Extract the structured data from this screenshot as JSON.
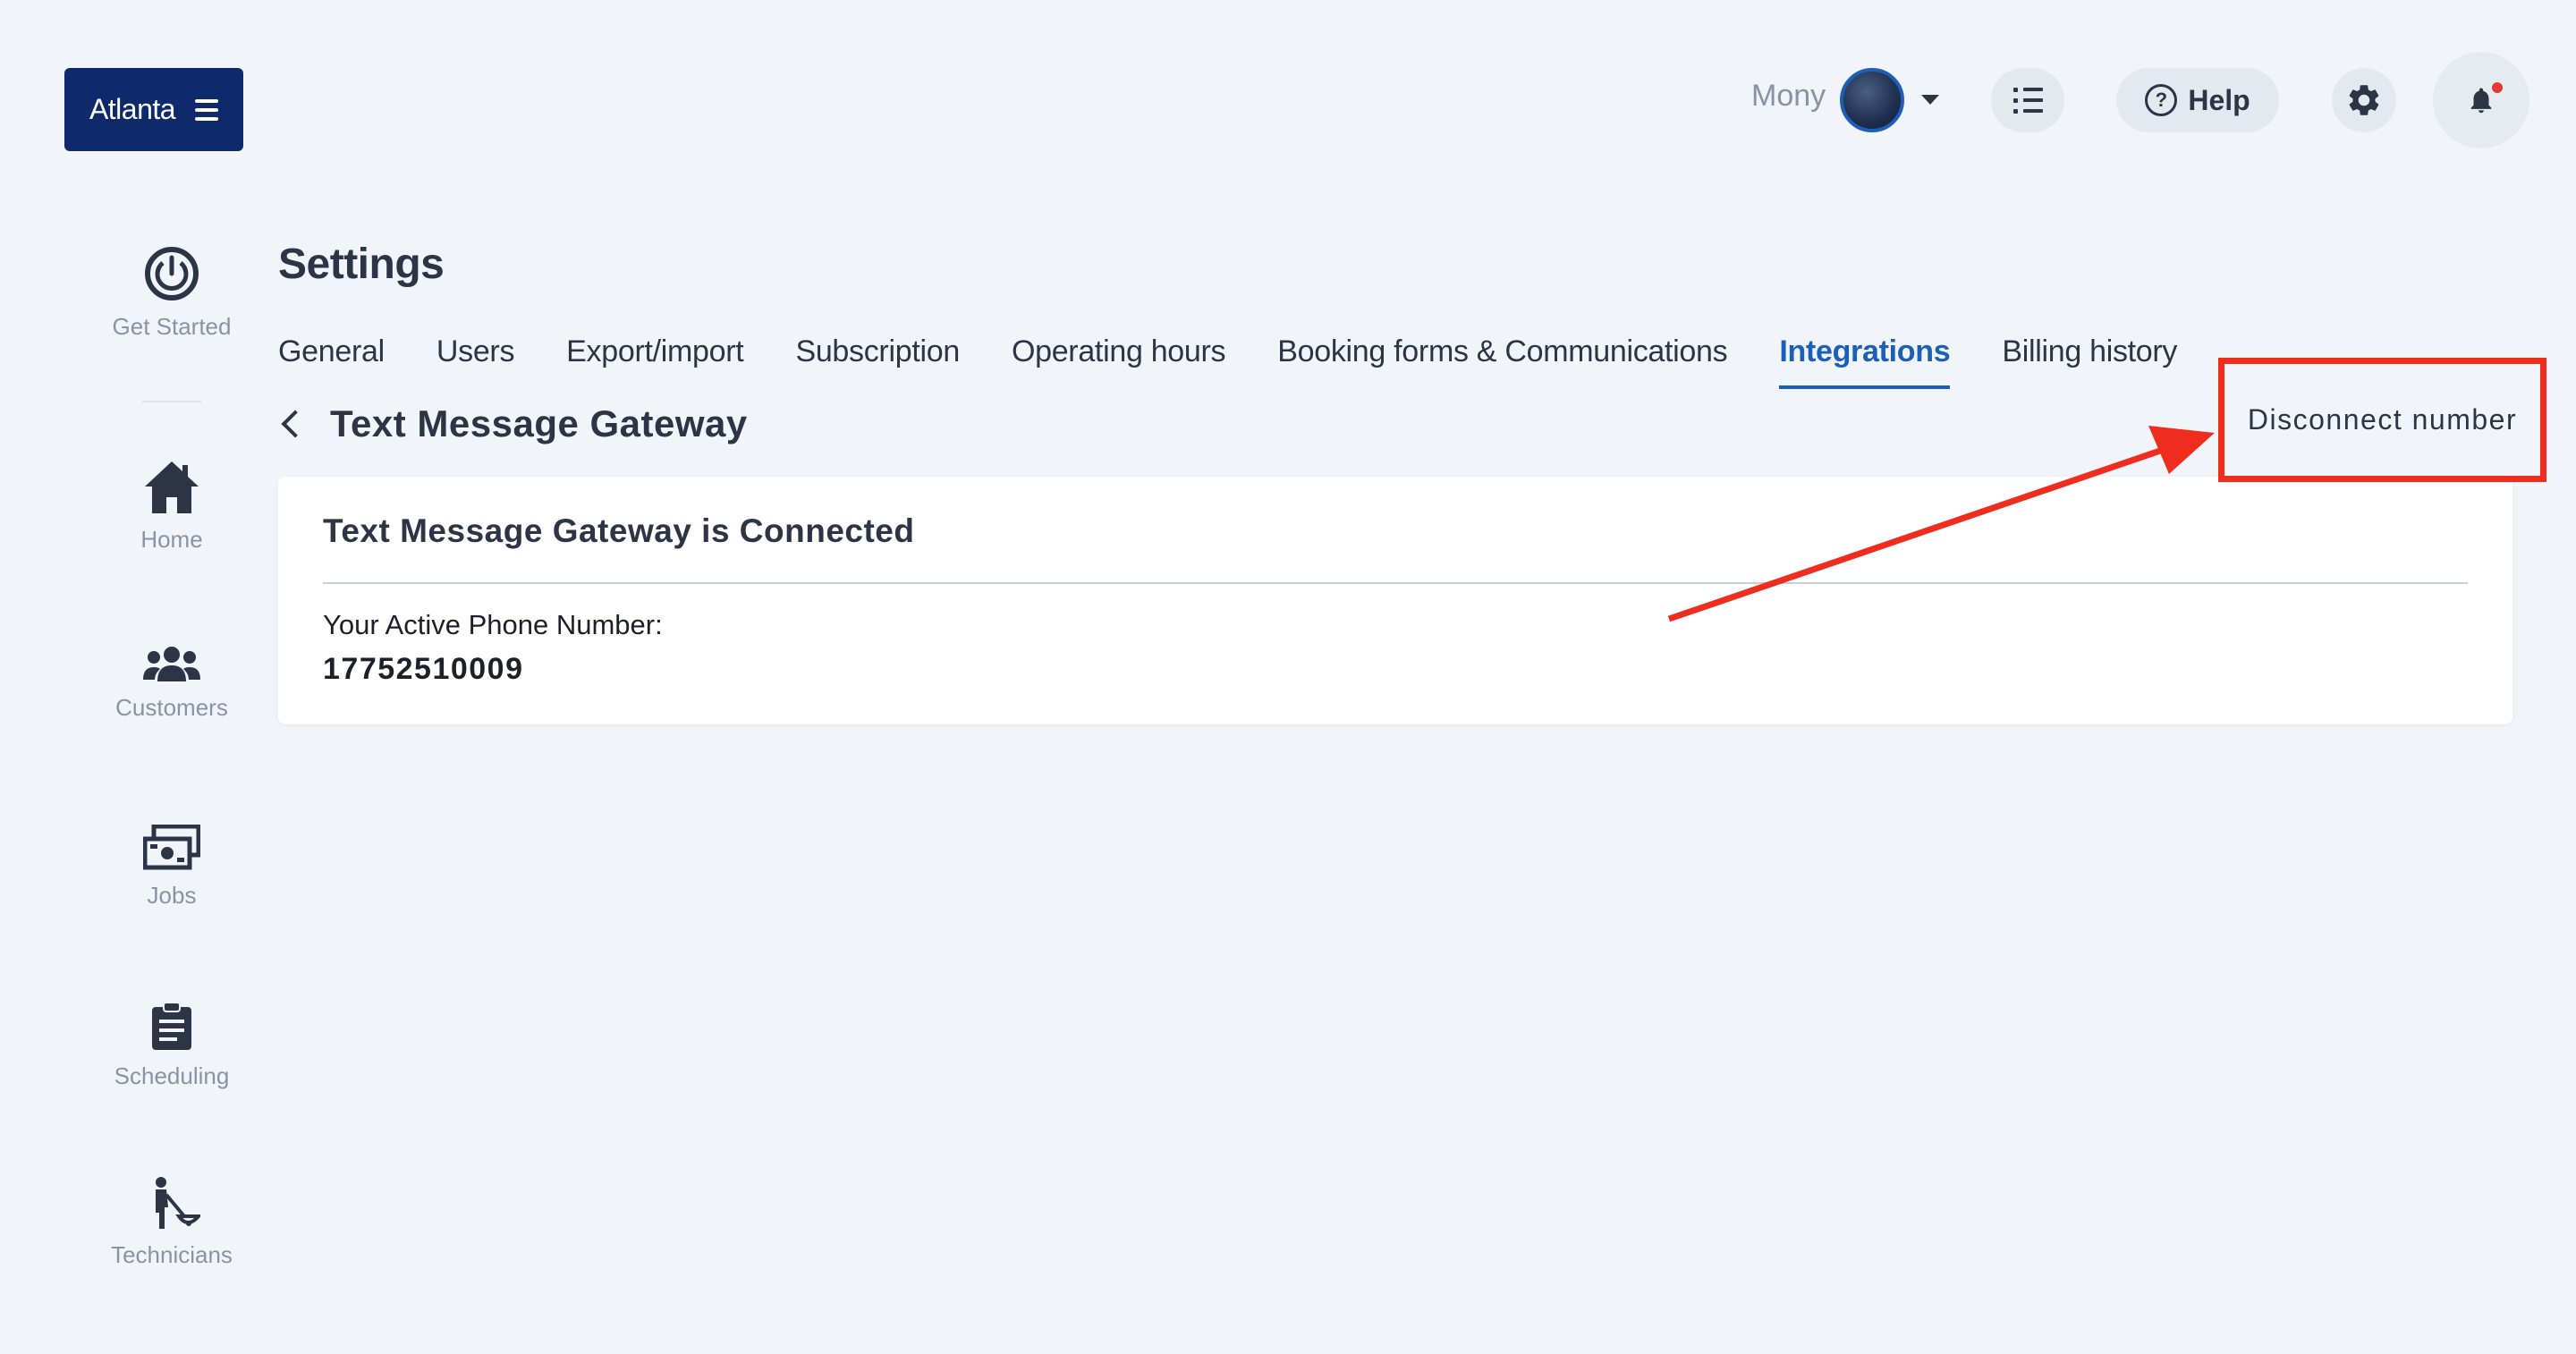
{
  "brand": {
    "label": "Atlanta"
  },
  "header": {
    "user_name": "Mony",
    "help_label": "Help"
  },
  "sidebar": {
    "items": [
      {
        "label": "Get Started"
      },
      {
        "label": "Home"
      },
      {
        "label": "Customers"
      },
      {
        "label": "Jobs"
      },
      {
        "label": "Scheduling"
      },
      {
        "label": "Technicians"
      }
    ]
  },
  "page": {
    "title": "Settings",
    "tabs": [
      {
        "label": "General",
        "active": false
      },
      {
        "label": "Users",
        "active": false
      },
      {
        "label": "Export/import",
        "active": false
      },
      {
        "label": "Subscription",
        "active": false
      },
      {
        "label": "Operating hours",
        "active": false
      },
      {
        "label": "Booking forms & Communications",
        "active": false
      },
      {
        "label": "Integrations",
        "active": true
      },
      {
        "label": "Billing history",
        "active": false
      }
    ],
    "section_title": "Text Message Gateway",
    "disconnect_label": "Disconnect number"
  },
  "card": {
    "title": "Text Message Gateway is Connected",
    "phone_label": "Your Active Phone Number:",
    "phone_value": "17752510009"
  },
  "colors": {
    "brand": "#0f2a6b",
    "accent": "#1d5fb8",
    "annotation": "#ee2d1e",
    "notification_dot": "#e53935"
  }
}
